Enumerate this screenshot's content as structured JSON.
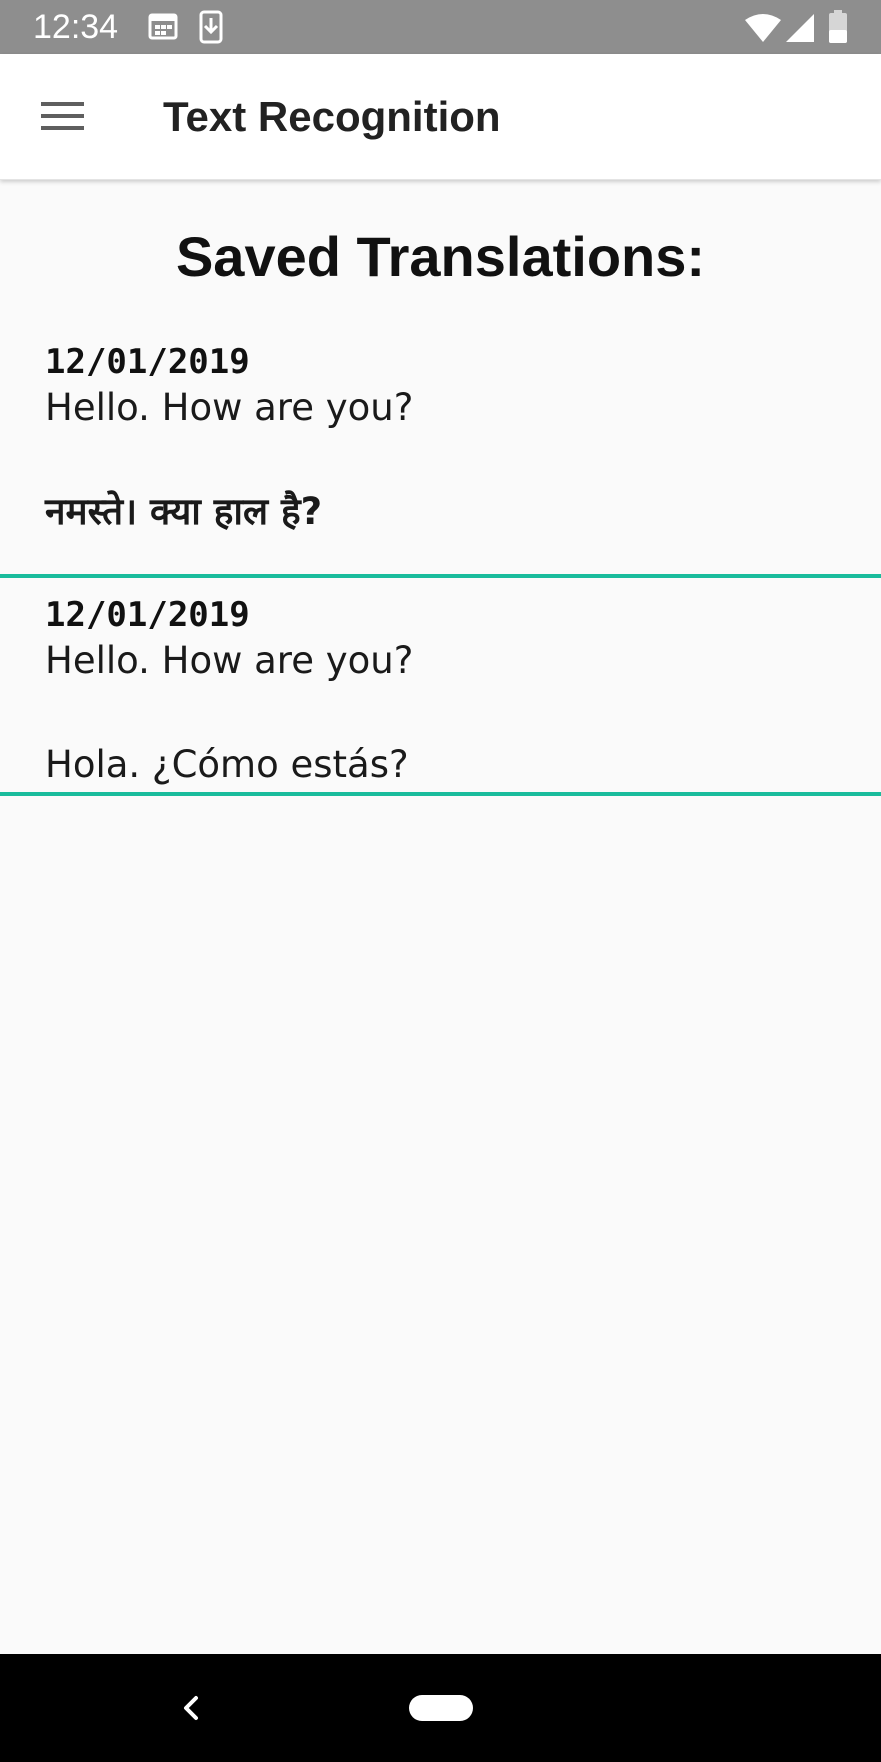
{
  "status_bar": {
    "time": "12:34",
    "icons": [
      "calendar-icon",
      "download-icon",
      "wifi-icon",
      "signal-icon",
      "battery-icon"
    ]
  },
  "app_bar": {
    "title": "Text Recognition",
    "menu_icon": "hamburger-menu-icon"
  },
  "page": {
    "title": "Saved Translations:"
  },
  "translations": [
    {
      "date": "12/01/2019",
      "source": "Hello. How are you?",
      "translation": "नमस्ते। क्या हाल है?"
    },
    {
      "date": "12/01/2019",
      "source": "Hello. How are you?",
      "translation": "Hola. ¿Cómo estás?"
    }
  ],
  "nav_bar": {
    "back_icon": "back-chevron-icon",
    "home_icon": "home-pill-icon"
  },
  "colors": {
    "status_bar": "#8e8e8e",
    "app_bar": "#ffffff",
    "background": "#fafafa",
    "divider_accent": "#1abc9c",
    "nav_bar": "#000000"
  }
}
